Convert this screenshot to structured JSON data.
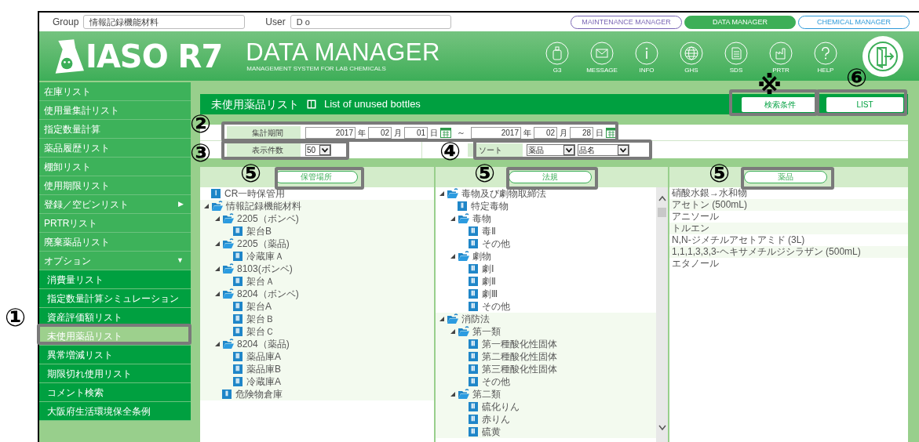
{
  "top_bar": {
    "group_label": "Group",
    "group_value": "情報記録機能材料",
    "user_label": "User",
    "user_value": "D o"
  },
  "app_tabs": [
    {
      "label": "MAINTENANCE MANAGER",
      "selected": false,
      "color": "#7b68b5"
    },
    {
      "label": "DATA MANAGER",
      "selected": true,
      "color": "#3daf57"
    },
    {
      "label": "CHEMICAL MANAGER",
      "selected": false,
      "color": "#2e9ad8"
    }
  ],
  "header": {
    "logo": "IASO R7",
    "title": "DATA MANAGER",
    "subtitle": "MANAGEMENT SYSTEM FOR LAB CHEMICALS"
  },
  "toolbar": [
    {
      "label": "G3",
      "kind": "bottle"
    },
    {
      "label": "MESSAGE",
      "kind": "mail"
    },
    {
      "label": "INFO",
      "kind": "info"
    },
    {
      "label": "GHS",
      "kind": "globe"
    },
    {
      "label": "SDS",
      "kind": "document"
    },
    {
      "label": "PRTR",
      "kind": "factory"
    },
    {
      "label": "HELP",
      "kind": "help"
    }
  ],
  "sidebar": {
    "items": [
      {
        "label": "在庫リスト",
        "selected": false
      },
      {
        "label": "使用量集計リスト",
        "selected": false
      },
      {
        "label": "指定数量計算",
        "selected": false
      },
      {
        "label": "薬品履歴リスト",
        "selected": false
      },
      {
        "label": "棚卸リスト",
        "selected": false
      },
      {
        "label": "使用期限リスト",
        "selected": false
      },
      {
        "label": "登録／空ビンリスト",
        "selected": false,
        "arrow": "▶"
      },
      {
        "label": "PRTRリスト",
        "selected": false
      },
      {
        "label": "廃棄薬品リスト",
        "selected": false
      },
      {
        "label": "オプション",
        "selected": false,
        "arrow": "▼",
        "children": [
          {
            "label": "消費量リスト",
            "selected": false
          },
          {
            "label": "指定数量計算シミュレーション",
            "selected": false
          },
          {
            "label": "資産評価額リスト",
            "selected": false
          },
          {
            "label": "未使用薬品リスト",
            "selected": true
          },
          {
            "label": "異常増減リスト",
            "selected": false
          },
          {
            "label": "期限切れ使用リスト",
            "selected": false
          },
          {
            "label": "コメント検索",
            "selected": false
          },
          {
            "label": "大阪府生活環境保全条例",
            "selected": false
          }
        ]
      }
    ]
  },
  "page": {
    "title": "未使用薬品リスト",
    "subtitle": "List of unused bottles",
    "buttons": [
      "検索条件",
      "LIST"
    ]
  },
  "filters": {
    "period_label": "集計期間",
    "from": {
      "year": "2017",
      "year_unit": "年",
      "month": "02",
      "month_unit": "月",
      "day": "01",
      "day_unit": "日"
    },
    "separator": "～",
    "to": {
      "year": "2017",
      "year_unit": "年",
      "month": "02",
      "month_unit": "月",
      "day": "28",
      "day_unit": "日"
    },
    "count_label": "表示件数",
    "count": "50",
    "sort_label": "ソート",
    "sort_primary": "薬品",
    "sort_secondary": "品名"
  },
  "columns": [
    {
      "header": "保管場所",
      "kind": "tree",
      "items": [
        {
          "label": "CR一時保管用",
          "badge": "Ⅰ"
        },
        {
          "label": "情報記録機能材料",
          "expanded": true,
          "children": [
            {
              "label": "2205（ボンベ)",
              "expanded": true,
              "children": [
                {
                  "label": "架台B",
                  "badge": "Ⅲ"
                }
              ]
            },
            {
              "label": "2205（薬品)",
              "expanded": true,
              "children": [
                {
                  "label": "冷蔵庫Ａ",
                  "badge": "Ⅲ"
                }
              ]
            },
            {
              "label": "8103(ボンベ)",
              "expanded": true,
              "children": [
                {
                  "label": "架台Ａ",
                  "badge": "Ⅲ"
                }
              ]
            },
            {
              "label": "8204（ボンベ)",
              "expanded": true,
              "children": [
                {
                  "label": "架台A",
                  "badge": "Ⅲ"
                },
                {
                  "label": "架台Ｂ",
                  "badge": "Ⅲ"
                },
                {
                  "label": "架台Ｃ",
                  "badge": "Ⅲ"
                }
              ]
            },
            {
              "label": "8204（薬品)",
              "expanded": true,
              "children": [
                {
                  "label": "薬品庫A",
                  "badge": "Ⅲ"
                },
                {
                  "label": "薬品庫B",
                  "badge": "Ⅲ"
                },
                {
                  "label": "冷蔵庫A",
                  "badge": "Ⅲ"
                }
              ]
            },
            {
              "label": "危険物倉庫",
              "badge": "Ⅱ"
            }
          ]
        }
      ]
    },
    {
      "header": "法規",
      "kind": "tree",
      "items": [
        {
          "label": "毒物及び劇物取締法",
          "expanded": true,
          "children": [
            {
              "label": "特定毒物",
              "badge": "Ⅱ"
            },
            {
              "label": "毒物",
              "expanded": true,
              "children": [
                {
                  "label": "毒Ⅱ",
                  "badge": "Ⅲ"
                },
                {
                  "label": "その他",
                  "badge": "Ⅲ"
                }
              ]
            },
            {
              "label": "劇物",
              "expanded": true,
              "children": [
                {
                  "label": "劇Ⅰ",
                  "badge": "Ⅲ"
                },
                {
                  "label": "劇Ⅱ",
                  "badge": "Ⅲ"
                },
                {
                  "label": "劇Ⅲ",
                  "badge": "Ⅲ"
                },
                {
                  "label": "その他",
                  "badge": "Ⅲ"
                }
              ]
            }
          ]
        },
        {
          "label": "消防法",
          "expanded": true,
          "children": [
            {
              "label": "第一類",
              "expanded": true,
              "children": [
                {
                  "label": "第一種酸化性固体",
                  "badge": "Ⅲ"
                },
                {
                  "label": "第二種酸化性固体",
                  "badge": "Ⅲ"
                },
                {
                  "label": "第三種酸化性固体",
                  "badge": "Ⅲ"
                },
                {
                  "label": "その他",
                  "badge": "Ⅲ"
                }
              ]
            },
            {
              "label": "第二類",
              "expanded": true,
              "children": [
                {
                  "label": "硫化りん",
                  "badge": "Ⅲ"
                },
                {
                  "label": "赤りん",
                  "badge": "Ⅲ"
                },
                {
                  "label": "硫黄",
                  "badge": "Ⅲ"
                }
              ]
            }
          ]
        }
      ]
    },
    {
      "header": "薬品",
      "kind": "list",
      "items": [
        "硝酸水銀→水和物",
        "アセトン (500mL)",
        "アニソール",
        "トルエン",
        "N,N-ジメチルアセトアミド (3L)",
        "1,1,1,3,3,3-ヘキサメチルジシラザン (500mL)",
        "エタノール"
      ]
    }
  ],
  "callouts": [
    {
      "label": "①"
    },
    {
      "label": "②"
    },
    {
      "label": "③"
    },
    {
      "label": "④"
    },
    {
      "label": "⑤"
    },
    {
      "label": "⑤"
    },
    {
      "label": "⑤"
    },
    {
      "label": "※"
    },
    {
      "label": "⑥"
    }
  ]
}
